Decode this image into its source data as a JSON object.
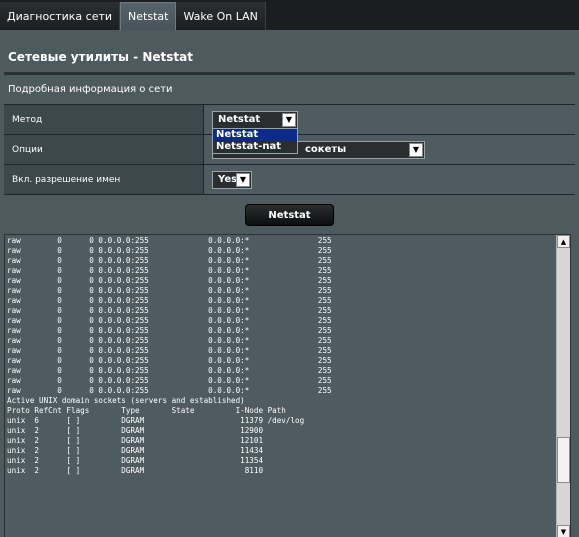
{
  "tabs": [
    {
      "label": "Диагностика сети",
      "active": false
    },
    {
      "label": "Netstat",
      "active": true
    },
    {
      "label": "Wake On LAN",
      "active": false
    }
  ],
  "page_title": "Сетевые утилиты - Netstat",
  "subtitle": "Подробная информация о сети",
  "form": {
    "method_label": "Метод",
    "method_value": "Netstat",
    "method_options": [
      "Netstat",
      "Netstat-nat"
    ],
    "options_label": "Опции",
    "options_value": "сокеты",
    "resolve_label": "Вкл. разрешение имен",
    "resolve_value": "Yes"
  },
  "run_button": "Netstat",
  "output_lines": [
    "raw        0      0 0.0.0.0:255             0.0.0.0:*               255",
    "raw        0      0 0.0.0.0:255             0.0.0.0:*               255",
    "raw        0      0 0.0.0.0:255             0.0.0.0:*               255",
    "raw        0      0 0.0.0.0:255             0.0.0.0:*               255",
    "raw        0      0 0.0.0.0:255             0.0.0.0:*               255",
    "raw        0      0 0.0.0.0:255             0.0.0.0:*               255",
    "raw        0      0 0.0.0.0:255             0.0.0.0:*               255",
    "raw        0      0 0.0.0.0:255             0.0.0.0:*               255",
    "raw        0      0 0.0.0.0:255             0.0.0.0:*               255",
    "raw        0      0 0.0.0.0:255             0.0.0.0:*               255",
    "raw        0      0 0.0.0.0:255             0.0.0.0:*               255",
    "raw        0      0 0.0.0.0:255             0.0.0.0:*               255",
    "raw        0      0 0.0.0.0:255             0.0.0.0:*               255",
    "raw        0      0 0.0.0.0:255             0.0.0.0:*               255",
    "raw        0      0 0.0.0.0:255             0.0.0.0:*               255",
    "raw        0      0 0.0.0.0:255             0.0.0.0:*               255",
    "Active UNIX domain sockets (servers and established)",
    "Proto RefCnt Flags       Type       State         I-Node Path",
    "unix  6      [ ]         DGRAM                     11379 /dev/log",
    "unix  2      [ ]         DGRAM                     12900",
    "unix  2      [ ]         DGRAM                     12101",
    "unix  2      [ ]         DGRAM                     11434",
    "unix  2      [ ]         DGRAM                     11354",
    "unix  2      [ ]         DGRAM                      8110"
  ],
  "scroll_position": 0.82,
  "icons": {
    "dropdown_arrow": "chevron-down-icon",
    "scroll_up": "arrow-up-icon",
    "scroll_down": "arrow-down-icon"
  },
  "colors": {
    "background": "#4d5a5e",
    "tabbar": "#1b1d1f",
    "selected_option": "#0b2a8a"
  }
}
